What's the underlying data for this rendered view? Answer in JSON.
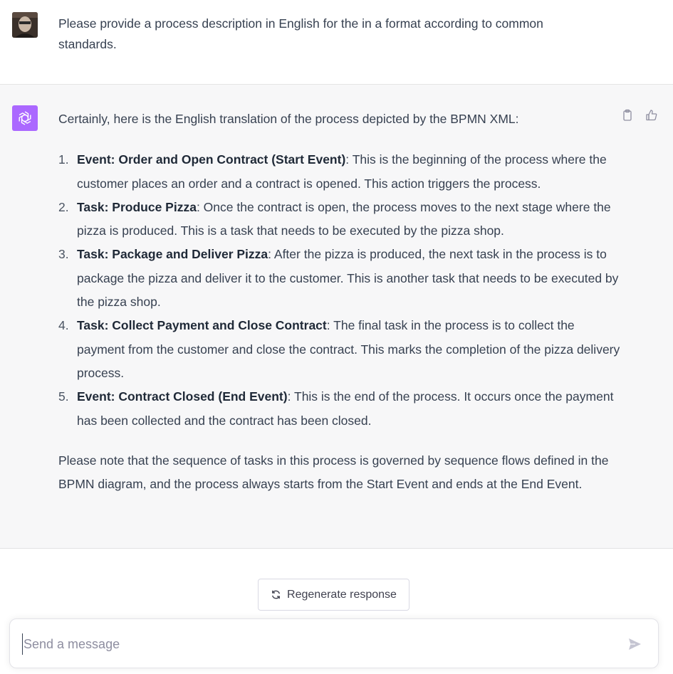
{
  "user": {
    "message": "Please provide a process description in English for the in a format according to common standards."
  },
  "assistant": {
    "intro": "Certainly, here is the English translation of the process depicted by the BPMN XML:",
    "steps": [
      {
        "num": "1.",
        "title": "Event: Order and Open Contract (Start Event)",
        "text": ": This is the beginning of the process where the customer places an order and a contract is opened. This action triggers the process."
      },
      {
        "num": "2.",
        "title": "Task: Produce Pizza",
        "text": ": Once the contract is open, the process moves to the next stage where the pizza is produced. This is a task that needs to be executed by the pizza shop."
      },
      {
        "num": "3.",
        "title": "Task: Package and Deliver Pizza",
        "text": ": After the pizza is produced, the next task in the process is to package the pizza and deliver it to the customer. This is another task that needs to be executed by the pizza shop."
      },
      {
        "num": "4.",
        "title": "Task: Collect Payment and Close Contract",
        "text": ": The final task in the process is to collect the payment from the customer and close the contract. This marks the completion of the pizza delivery process."
      },
      {
        "num": "5.",
        "title": "Event: Contract Closed (End Event)",
        "text": ": This is the end of the process. It occurs once the payment has been collected and the contract has been closed."
      }
    ],
    "note": "Please note that the sequence of tasks in this process is governed by sequence flows defined in the BPMN diagram, and the process always starts from the Start Event and ends at the End Event."
  },
  "regenerate_label": "Regenerate response",
  "composer": {
    "placeholder": "Send a message",
    "value": ""
  },
  "icons": {
    "user_avatar": "user-photo",
    "bot_avatar": "openai-logo-icon",
    "copy": "clipboard-icon",
    "like": "thumbs-up-icon",
    "dislike": "thumbs-down-icon",
    "regenerate": "refresh-icon",
    "send": "send-icon"
  },
  "colors": {
    "bot_avatar_bg": "#ab68ff",
    "assistant_bg": "#f7f7f8"
  }
}
